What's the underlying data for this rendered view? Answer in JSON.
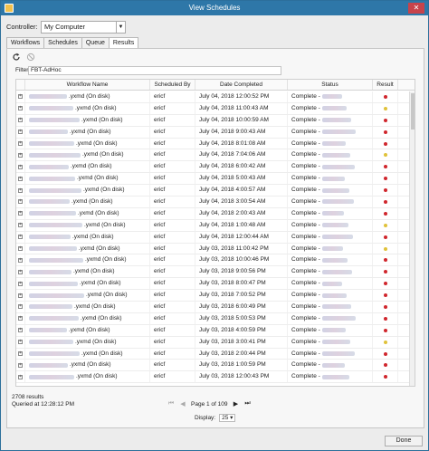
{
  "window": {
    "title": "View Schedules",
    "close_label": "✕"
  },
  "controller": {
    "label": "Controller:",
    "value": "My Computer"
  },
  "tabs": [
    {
      "label": "Workflows"
    },
    {
      "label": "Schedules"
    },
    {
      "label": "Queue"
    },
    {
      "label": "Results"
    }
  ],
  "filter": {
    "label": "Filter:",
    "value": "FBT-AdHoc"
  },
  "grid": {
    "headers": {
      "name": "Workflow Name",
      "by": "Scheduled By",
      "date": "Date Completed",
      "status": "Status",
      "result": "Result"
    },
    "rows": [
      {
        "name": ".yxmd (On disk)",
        "by": "ericf",
        "date": "July 04, 2018 12:00:52 PM",
        "status": "Complete -",
        "result": "error"
      },
      {
        "name": ".yxmd (On disk)",
        "by": "ericf",
        "date": "July 04, 2018 11:00:43 AM",
        "status": "Complete -",
        "result": "warning"
      },
      {
        "name": ".yxmd (On disk)",
        "by": "ericf",
        "date": "July 04, 2018 10:00:59 AM",
        "status": "Complete -",
        "result": "error"
      },
      {
        "name": ".yxmd (On disk)",
        "by": "ericf",
        "date": "July 04, 2018 9:00:43 AM",
        "status": "Complete -",
        "result": "error"
      },
      {
        "name": ".yxmd (On disk)",
        "by": "ericf",
        "date": "July 04, 2018 8:01:08 AM",
        "status": "Complete -",
        "result": "error"
      },
      {
        "name": ".yxmd (On disk)",
        "by": "ericf",
        "date": "July 04, 2018 7:04:06 AM",
        "status": "Complete -",
        "result": "warning"
      },
      {
        "name": ".yxmd (On disk)",
        "by": "ericf",
        "date": "July 04, 2018 6:00:42 AM",
        "status": "Complete -",
        "result": "error"
      },
      {
        "name": ".yxmd (On disk)",
        "by": "ericf",
        "date": "July 04, 2018 5:00:43 AM",
        "status": "Complete -",
        "result": "error"
      },
      {
        "name": ".yxmd (On disk)",
        "by": "ericf",
        "date": "July 04, 2018 4:00:57 AM",
        "status": "Complete -",
        "result": "error"
      },
      {
        "name": ".yxmd (On disk)",
        "by": "ericf",
        "date": "July 04, 2018 3:00:54 AM",
        "status": "Complete -",
        "result": "error"
      },
      {
        "name": ".yxmd (On disk)",
        "by": "ericf",
        "date": "July 04, 2018 2:00:43 AM",
        "status": "Complete -",
        "result": "error"
      },
      {
        "name": ".yxmd (On disk)",
        "by": "ericf",
        "date": "July 04, 2018 1:00:48 AM",
        "status": "Complete -",
        "result": "warning"
      },
      {
        "name": ".yxmd (On disk)",
        "by": "ericf",
        "date": "July 04, 2018 12:00:44 AM",
        "status": "Complete -",
        "result": "error"
      },
      {
        "name": ".yxmd (On disk)",
        "by": "ericf",
        "date": "July 03, 2018 11:00:42 PM",
        "status": "Complete -",
        "result": "warning"
      },
      {
        "name": ".yxmd (On disk)",
        "by": "ericf",
        "date": "July 03, 2018 10:00:46 PM",
        "status": "Complete -",
        "result": "error"
      },
      {
        "name": ".yxmd (On disk)",
        "by": "ericf",
        "date": "July 03, 2018 9:00:56 PM",
        "status": "Complete -",
        "result": "error"
      },
      {
        "name": ".yxmd (On disk)",
        "by": "ericf",
        "date": "July 03, 2018 8:00:47 PM",
        "status": "Complete -",
        "result": "error"
      },
      {
        "name": ".yxmd (On disk)",
        "by": "ericf",
        "date": "July 03, 2018 7:00:52 PM",
        "status": "Complete -",
        "result": "error"
      },
      {
        "name": ".yxmd (On disk)",
        "by": "ericf",
        "date": "July 03, 2018 6:00:49 PM",
        "status": "Complete -",
        "result": "error"
      },
      {
        "name": ".yxmd (On disk)",
        "by": "ericf",
        "date": "July 03, 2018 5:00:53 PM",
        "status": "Complete -",
        "result": "error"
      },
      {
        "name": ".yxmd (On disk)",
        "by": "ericf",
        "date": "July 03, 2018 4:00:59 PM",
        "status": "Complete -",
        "result": "error"
      },
      {
        "name": ".yxmd (On disk)",
        "by": "ericf",
        "date": "July 03, 2018 3:00:41 PM",
        "status": "Complete -",
        "result": "warning"
      },
      {
        "name": ".yxmd (On disk)",
        "by": "ericf",
        "date": "July 03, 2018 2:00:44 PM",
        "status": "Complete -",
        "result": "error"
      },
      {
        "name": ".yxmd (On disk)",
        "by": "ericf",
        "date": "July 03, 2018 1:00:59 PM",
        "status": "Complete -",
        "result": "error"
      },
      {
        "name": ".yxmd (On disk)",
        "by": "ericf",
        "date": "July 03, 2018 12:00:43 PM",
        "status": "Complete -",
        "result": "error"
      }
    ]
  },
  "footer": {
    "results_count": "2708 results",
    "queried_at": "Queried at 12:28:12 PM",
    "page_text": "Page 1 of 109",
    "display_label": "Display:",
    "display_value": "25"
  },
  "done_label": "Done",
  "colors": {
    "error": "#d0262d",
    "warning": "#e0c23a",
    "titlebar": "#2e77a8"
  }
}
